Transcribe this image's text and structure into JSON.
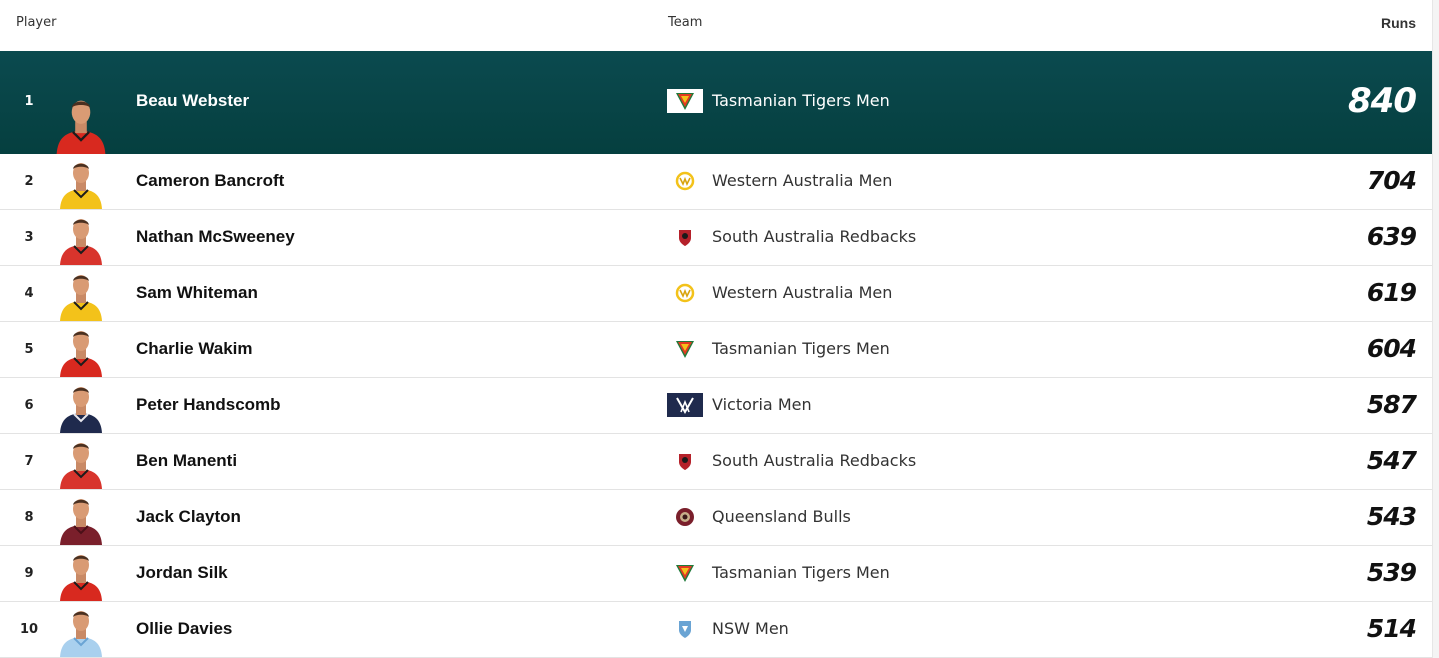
{
  "header": {
    "player": "Player",
    "team": "Team",
    "runs": "Runs"
  },
  "rows": [
    {
      "rank": "1",
      "name": "Beau Webster",
      "team": "Tasmanian Tigers Men",
      "runs": "840",
      "kit": "tas"
    },
    {
      "rank": "2",
      "name": "Cameron Bancroft",
      "team": "Western Australia Men",
      "runs": "704",
      "kit": "wa"
    },
    {
      "rank": "3",
      "name": "Nathan McSweeney",
      "team": "South Australia Redbacks",
      "runs": "639",
      "kit": "sa"
    },
    {
      "rank": "4",
      "name": "Sam Whiteman",
      "team": "Western Australia Men",
      "runs": "619",
      "kit": "wa"
    },
    {
      "rank": "5",
      "name": "Charlie Wakim",
      "team": "Tasmanian Tigers Men",
      "runs": "604",
      "kit": "tas"
    },
    {
      "rank": "6",
      "name": "Peter Handscomb",
      "team": "Victoria Men",
      "runs": "587",
      "kit": "vic"
    },
    {
      "rank": "7",
      "name": "Ben Manenti",
      "team": "South Australia Redbacks",
      "runs": "547",
      "kit": "sa"
    },
    {
      "rank": "8",
      "name": "Jack Clayton",
      "team": "Queensland Bulls",
      "runs": "543",
      "kit": "qld"
    },
    {
      "rank": "9",
      "name": "Jordan Silk",
      "team": "Tasmanian Tigers Men",
      "runs": "539",
      "kit": "tas"
    },
    {
      "rank": "10",
      "name": "Ollie Davies",
      "team": "NSW Men",
      "runs": "514",
      "kit": "nsw"
    }
  ],
  "colors": {
    "highlight_bg": "#053f3f",
    "tas": "#d8291f",
    "wa": "#f3c21a",
    "sa": "#d02b2b",
    "vic": "#1f2a4d",
    "qld": "#7a1f2b",
    "nsw": "#9fc8ea"
  },
  "icons": {
    "tas": "tasmanian-tigers-logo-icon",
    "wa": "western-australia-logo-icon",
    "sa": "south-australia-redbacks-logo-icon",
    "vic": "victoria-logo-icon",
    "qld": "queensland-bulls-logo-icon",
    "nsw": "nsw-logo-icon"
  }
}
